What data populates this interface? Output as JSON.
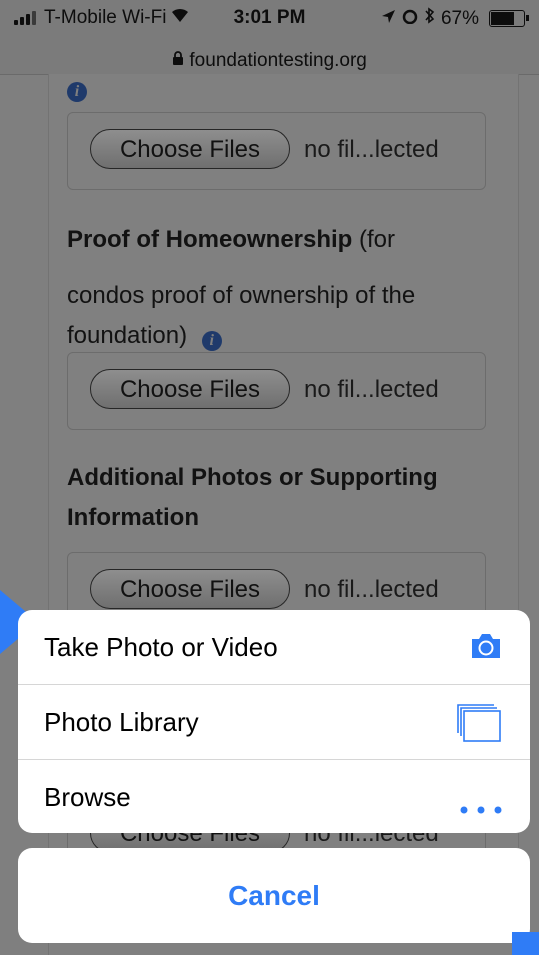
{
  "status_bar": {
    "carrier": "T-Mobile Wi-Fi",
    "time": "3:01 PM",
    "battery": "67%",
    "battery_level": 0.67
  },
  "url_bar": {
    "domain": "foundationtesting.org"
  },
  "form": {
    "file_fields": [
      {
        "button_label": "Choose Files",
        "status": "no fil...lected"
      },
      {
        "button_label": "Choose Files",
        "status": "no fil...lected"
      },
      {
        "button_label": "Choose Files",
        "status": "no fil...lected"
      },
      {
        "button_label": "Choose Files",
        "status": "no fil...lected"
      }
    ],
    "homeownership_label_bold": "Proof of Homeownership",
    "homeownership_label_rest_1": " (for",
    "homeownership_label_rest_2": "condos proof of ownership of the",
    "homeownership_label_rest_3": "foundation)",
    "additional_label_line1": "Additional Photos or Supporting",
    "additional_label_line2": "Information"
  },
  "action_sheet": {
    "items": [
      {
        "label": "Take Photo or Video",
        "icon": "camera-icon"
      },
      {
        "label": "Photo Library",
        "icon": "photo-library-icon"
      },
      {
        "label": "Browse",
        "icon": "more-icon"
      }
    ],
    "cancel_label": "Cancel"
  },
  "colors": {
    "accent": "#2f7cf6",
    "dim_overlay": "#7f7f7f"
  }
}
